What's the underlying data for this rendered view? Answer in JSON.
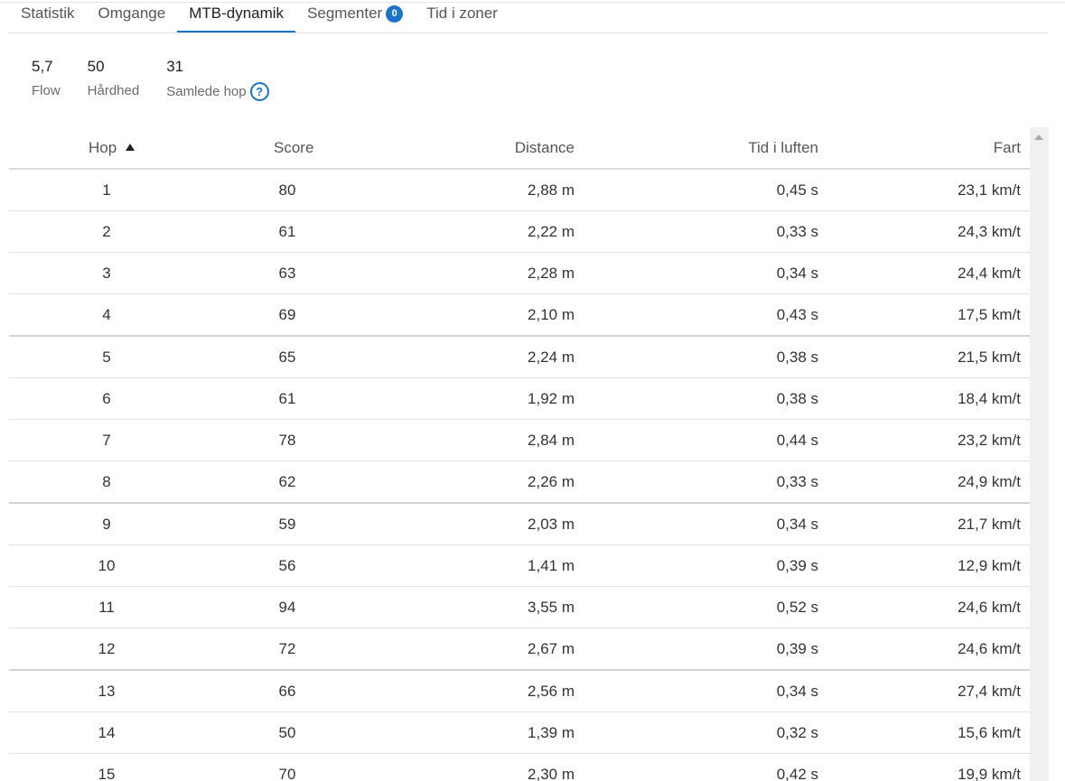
{
  "tabs": [
    {
      "label": "Statistik"
    },
    {
      "label": "Omgange"
    },
    {
      "label": "MTB-dynamik"
    },
    {
      "label": "Segmenter",
      "badge": "0"
    },
    {
      "label": "Tid i zoner"
    }
  ],
  "summary": {
    "flow": {
      "value": "5,7",
      "label": "Flow"
    },
    "hardness": {
      "value": "50",
      "label": "Hårdhed"
    },
    "jumps": {
      "value": "31",
      "label": "Samlede hop",
      "help_icon": "question-circle"
    }
  },
  "table": {
    "headers": {
      "hop": "Hop",
      "score": "Score",
      "distance": "Distance",
      "airtime": "Tid i luften",
      "speed": "Fart"
    },
    "sort": {
      "column": "hop",
      "direction": "ascending"
    },
    "rows": [
      {
        "hop": "1",
        "score": "80",
        "distance": "2,88 m",
        "airtime": "0,45 s",
        "speed": "23,1 km/t"
      },
      {
        "hop": "2",
        "score": "61",
        "distance": "2,22 m",
        "airtime": "0,33 s",
        "speed": "24,3 km/t"
      },
      {
        "hop": "3",
        "score": "63",
        "distance": "2,28 m",
        "airtime": "0,34 s",
        "speed": "24,4 km/t"
      },
      {
        "hop": "4",
        "score": "69",
        "distance": "2,10 m",
        "airtime": "0,43 s",
        "speed": "17,5 km/t"
      },
      {
        "hop": "5",
        "score": "65",
        "distance": "2,24 m",
        "airtime": "0,38 s",
        "speed": "21,5 km/t"
      },
      {
        "hop": "6",
        "score": "61",
        "distance": "1,92 m",
        "airtime": "0,38 s",
        "speed": "18,4 km/t"
      },
      {
        "hop": "7",
        "score": "78",
        "distance": "2,84 m",
        "airtime": "0,44 s",
        "speed": "23,2 km/t"
      },
      {
        "hop": "8",
        "score": "62",
        "distance": "2,26 m",
        "airtime": "0,33 s",
        "speed": "24,9 km/t"
      },
      {
        "hop": "9",
        "score": "59",
        "distance": "2,03 m",
        "airtime": "0,34 s",
        "speed": "21,7 km/t"
      },
      {
        "hop": "10",
        "score": "56",
        "distance": "1,41 m",
        "airtime": "0,39 s",
        "speed": "12,9 km/t"
      },
      {
        "hop": "11",
        "score": "94",
        "distance": "3,55 m",
        "airtime": "0,52 s",
        "speed": "24,6 km/t"
      },
      {
        "hop": "12",
        "score": "72",
        "distance": "2,67 m",
        "airtime": "0,39 s",
        "speed": "24,6 km/t"
      },
      {
        "hop": "13",
        "score": "66",
        "distance": "2,56 m",
        "airtime": "0,34 s",
        "speed": "27,4 km/t"
      },
      {
        "hop": "14",
        "score": "50",
        "distance": "1,39 m",
        "airtime": "0,32 s",
        "speed": "15,6 km/t"
      },
      {
        "hop": "15",
        "score": "70",
        "distance": "2,30 m",
        "airtime": "0,42 s",
        "speed": "19,9 km/t"
      }
    ]
  },
  "colors": {
    "accent": "#1b73c8",
    "border": "#e2e2e2",
    "scrollbar": "#f0f0f0"
  }
}
